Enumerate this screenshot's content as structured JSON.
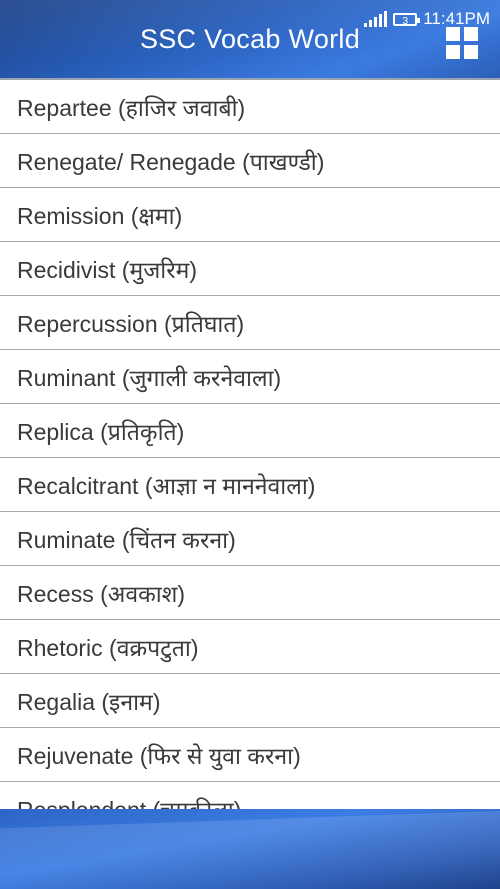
{
  "status_bar": {
    "battery_label": "3",
    "time": "11:41PM"
  },
  "app": {
    "title": "SSC Vocab World"
  },
  "words": [
    "Repartee (हाजिर जवाबी)",
    "Renegate/ Renegade (पाखण्डी)",
    "Remission (क्षमा)",
    "Recidivist (मुजरिम)",
    "Repercussion (प्रतिघात)",
    "Ruminant (जुगाली करनेवाला)",
    "Replica (प्रतिकृति)",
    "Recalcitrant (आज्ञा न माननेवाला)",
    "Ruminate (चिंतन करना)",
    "Recess (अवकाश)",
    "Rhetoric (वक्रपटुता)",
    "Regalia (इनाम)",
    "Rejuvenate (फिर से युवा करना)",
    "Resplendent (चमकीला)"
  ]
}
